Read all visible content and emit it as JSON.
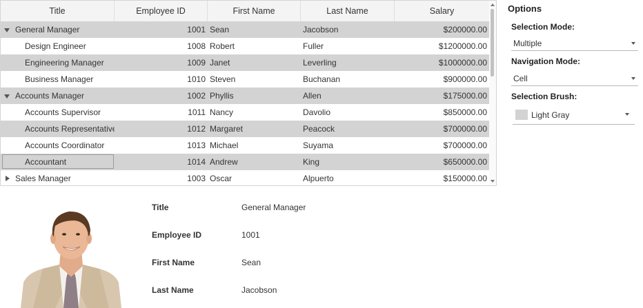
{
  "grid": {
    "columns": [
      "Title",
      "Employee ID",
      "First Name",
      "Last Name",
      "Salary"
    ],
    "rows": [
      {
        "title": "General Manager",
        "id": "1001",
        "first": "Sean",
        "last": "Jacobson",
        "salary": "$200000.00",
        "level": 0,
        "expander": "expanded",
        "selected": true
      },
      {
        "title": "Design Engineer",
        "id": "1008",
        "first": "Robert",
        "last": "Fuller",
        "salary": "$1200000.00",
        "level": 1,
        "expander": "none",
        "selected": false
      },
      {
        "title": "Engineering Manager",
        "id": "1009",
        "first": "Janet",
        "last": "Leverling",
        "salary": "$1000000.00",
        "level": 1,
        "expander": "none",
        "selected": true
      },
      {
        "title": "Business Manager",
        "id": "1010",
        "first": "Steven",
        "last": "Buchanan",
        "salary": "$900000.00",
        "level": 1,
        "expander": "none",
        "selected": false
      },
      {
        "title": "Accounts Manager",
        "id": "1002",
        "first": "Phyllis",
        "last": "Allen",
        "salary": "$175000.00",
        "level": 0,
        "expander": "expanded",
        "selected": true
      },
      {
        "title": "Accounts Supervisor",
        "id": "1011",
        "first": "Nancy",
        "last": "Davolio",
        "salary": "$850000.00",
        "level": 1,
        "expander": "none",
        "selected": false
      },
      {
        "title": "Accounts Representative",
        "id": "1012",
        "first": "Margaret",
        "last": "Peacock",
        "salary": "$700000.00",
        "level": 1,
        "expander": "none",
        "selected": true
      },
      {
        "title": "Accounts Coordinator",
        "id": "1013",
        "first": "Michael",
        "last": "Suyama",
        "salary": "$700000.00",
        "level": 1,
        "expander": "none",
        "selected": false
      },
      {
        "title": "Accountant",
        "id": "1014",
        "first": "Andrew",
        "last": "King",
        "salary": "$650000.00",
        "level": 1,
        "expander": "none",
        "selected": true,
        "focused": true
      },
      {
        "title": "Sales Manager",
        "id": "1003",
        "first": "Oscar",
        "last": "Alpuerto",
        "salary": "$150000.00",
        "level": 0,
        "expander": "collapsed",
        "selected": false
      }
    ]
  },
  "options": {
    "title": "Options",
    "selection_mode_label": "Selection Mode:",
    "selection_mode_value": "Multiple",
    "navigation_mode_label": "Navigation Mode:",
    "navigation_mode_value": "Cell",
    "selection_brush_label": "Selection Brush:",
    "selection_brush_value": "Light Gray",
    "selection_brush_color": "#d3d3d3"
  },
  "details": {
    "title_label": "Title",
    "title_value": "General Manager",
    "id_label": "Employee ID",
    "id_value": "1001",
    "first_label": "First Name",
    "first_value": "Sean",
    "last_label": "Last Name",
    "last_value": "Jacobson"
  },
  "colors": {
    "selected_row": "#d3d3d3",
    "header_bg": "#f4f4f4"
  }
}
